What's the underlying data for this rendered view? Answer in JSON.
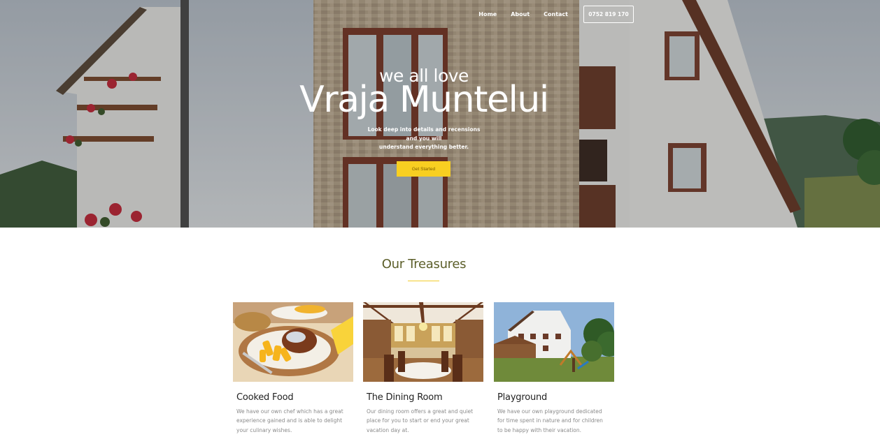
{
  "nav": {
    "links": [
      "Home",
      "About",
      "Contact"
    ],
    "phone": "0752 819 170"
  },
  "hero": {
    "subtitle": "we all love",
    "title": "Vraja Muntelui",
    "text_lines": [
      "Look deep into details and recensions",
      "and you will",
      "understand everything better."
    ],
    "cta": "Get Started"
  },
  "section": {
    "title": "Our Treasures"
  },
  "cards": [
    {
      "title": "Cooked Food",
      "text": "We have our own chef which has a great experience gained and is able to delight your culinary wishes."
    },
    {
      "title": "The Dining Room",
      "text": "Our dining room offers a great and quiet place for you to start or end your great vacation day at."
    },
    {
      "title": "Playground",
      "text": "We have our own playground dedicated for time spent in nature and for children to be happy with their vacation."
    }
  ],
  "colors": {
    "accent": "#f8cf21",
    "section_title": "#5c5f2a"
  }
}
